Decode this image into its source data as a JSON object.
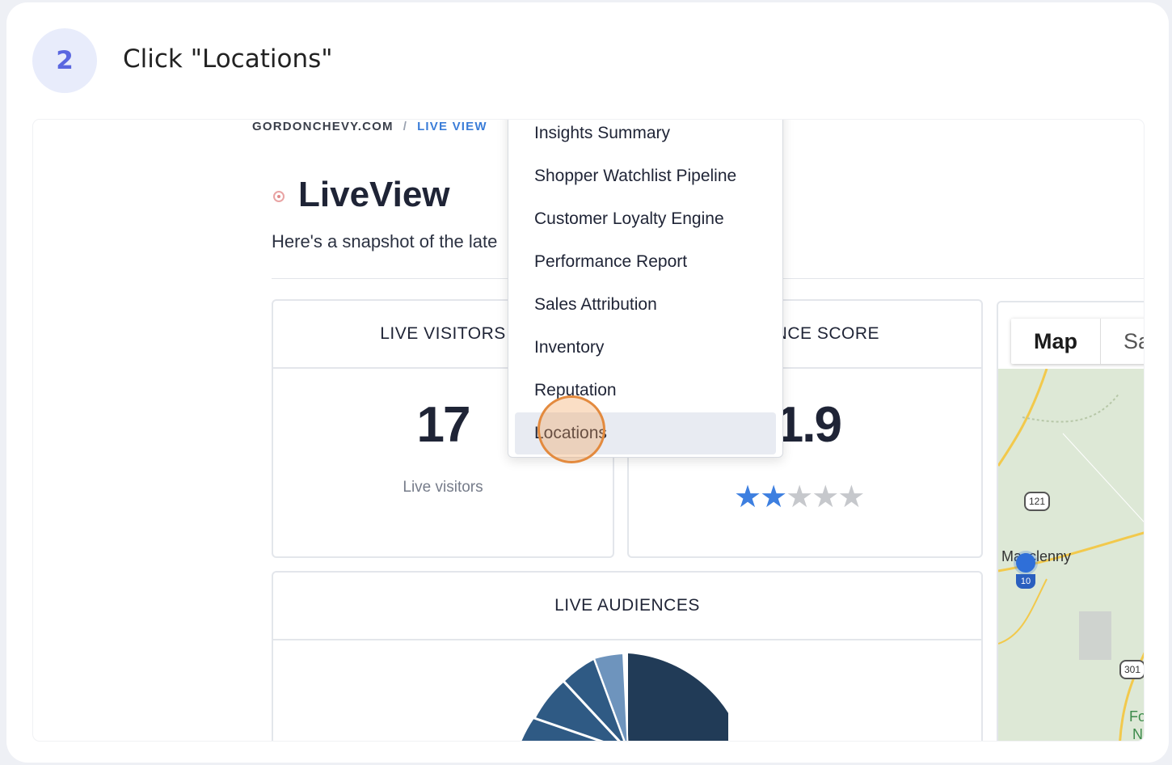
{
  "step": {
    "number": "2",
    "title": "Click \"Locations\""
  },
  "breadcrumb": {
    "site": "GORDONCHEVY.COM",
    "separator": "/",
    "current": "LIVE VIEW"
  },
  "page": {
    "title": "LiveView",
    "subtitle": "Here's a snapshot of the late"
  },
  "live_visitors": {
    "header": "LIVE VISITORS",
    "value": "17",
    "caption": "Live visitors"
  },
  "score": {
    "header": "ENCE SCORE",
    "value": "1.9",
    "rating": 2,
    "max": 5
  },
  "map": {
    "tab_map": "Map",
    "tab_sat": "Sa",
    "label_city": "Macclenny",
    "shield_121": "121",
    "interstate_10": "10",
    "shield_301": "301",
    "label_f": "Fo",
    "label_n": "N"
  },
  "audiences": {
    "header": "LIVE AUDIENCES"
  },
  "menu": {
    "items": [
      "Insights Summary",
      "Shopper Watchlist Pipeline",
      "Customer Loyalty Engine",
      "Performance Report",
      "Sales Attribution",
      "Inventory",
      "Reputation",
      "Locations"
    ],
    "active_index": 7
  },
  "colors": {
    "accent": "#5a67e0",
    "link": "#3b7dd8",
    "star": "#3d7fe0",
    "pie_dark": "#213b57",
    "pie_mid": "#2f5a84",
    "click": "#e38a3e"
  }
}
